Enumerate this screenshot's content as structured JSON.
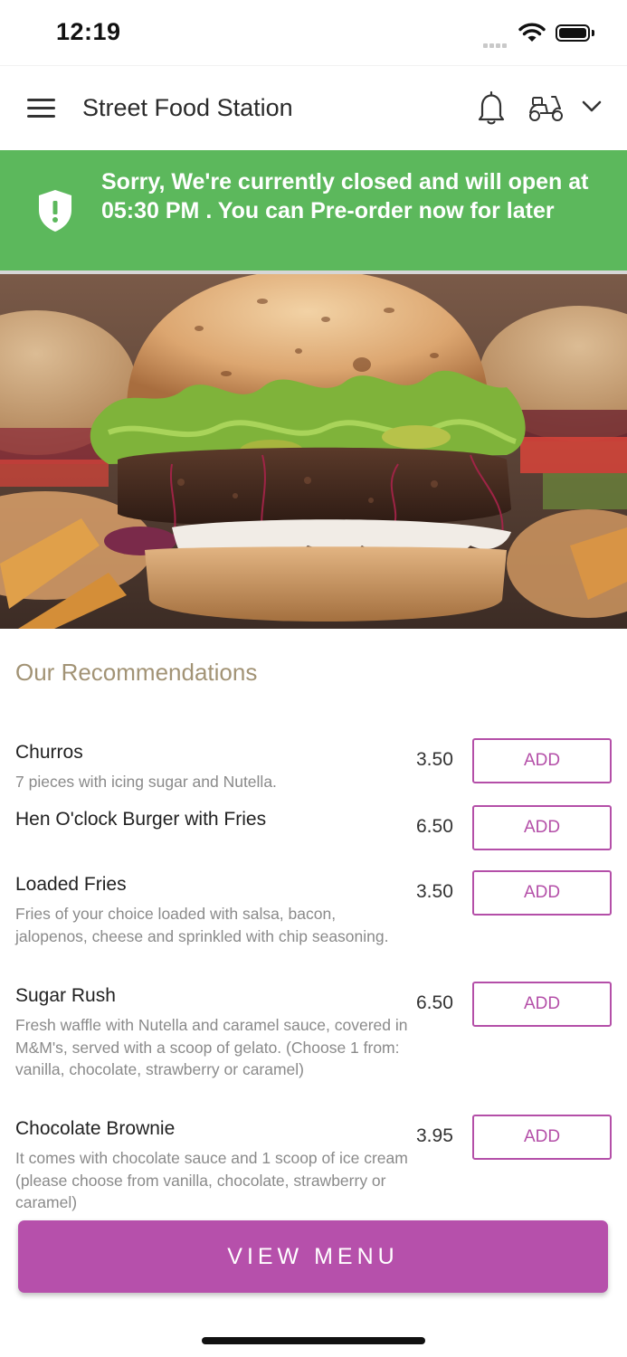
{
  "status": {
    "time": "12:19"
  },
  "header": {
    "title": "Street Food Station",
    "icons": [
      "menu-icon",
      "bell-icon",
      "scooter-icon",
      "chevron-down-icon"
    ]
  },
  "notice": {
    "message": "Sorry, We're currently closed and will open at 05:30 PM . You can Pre-order now for later",
    "color": "#5cb85c"
  },
  "recommendations": {
    "title": "Our Recommendations",
    "add_label": "ADD",
    "items": [
      {
        "name": "Churros",
        "desc": "7 pieces with icing sugar and Nutella.",
        "price": "3.50"
      },
      {
        "name": "Hen O'clock Burger with Fries",
        "desc": "",
        "price": "6.50"
      },
      {
        "name": "Loaded Fries",
        "desc": "Fries of your choice loaded with salsa, bacon, jalopenos, cheese and sprinkled with chip seasoning.",
        "price": "3.50"
      },
      {
        "name": "Sugar Rush",
        "desc": "Fresh waffle with Nutella and caramel sauce, covered in M&M's, served with a scoop of gelato. (Choose 1 from: vanilla, chocolate, strawberry or caramel)",
        "price": "6.50"
      },
      {
        "name": "Chocolate Brownie",
        "desc": "It comes with chocolate sauce and 1 scoop of ice cream (please choose from vanilla, chocolate, strawberry or caramel)",
        "price": "3.95"
      }
    ]
  },
  "footer": {
    "view_menu": "VIEW MENU",
    "accent": "#b650ab"
  }
}
